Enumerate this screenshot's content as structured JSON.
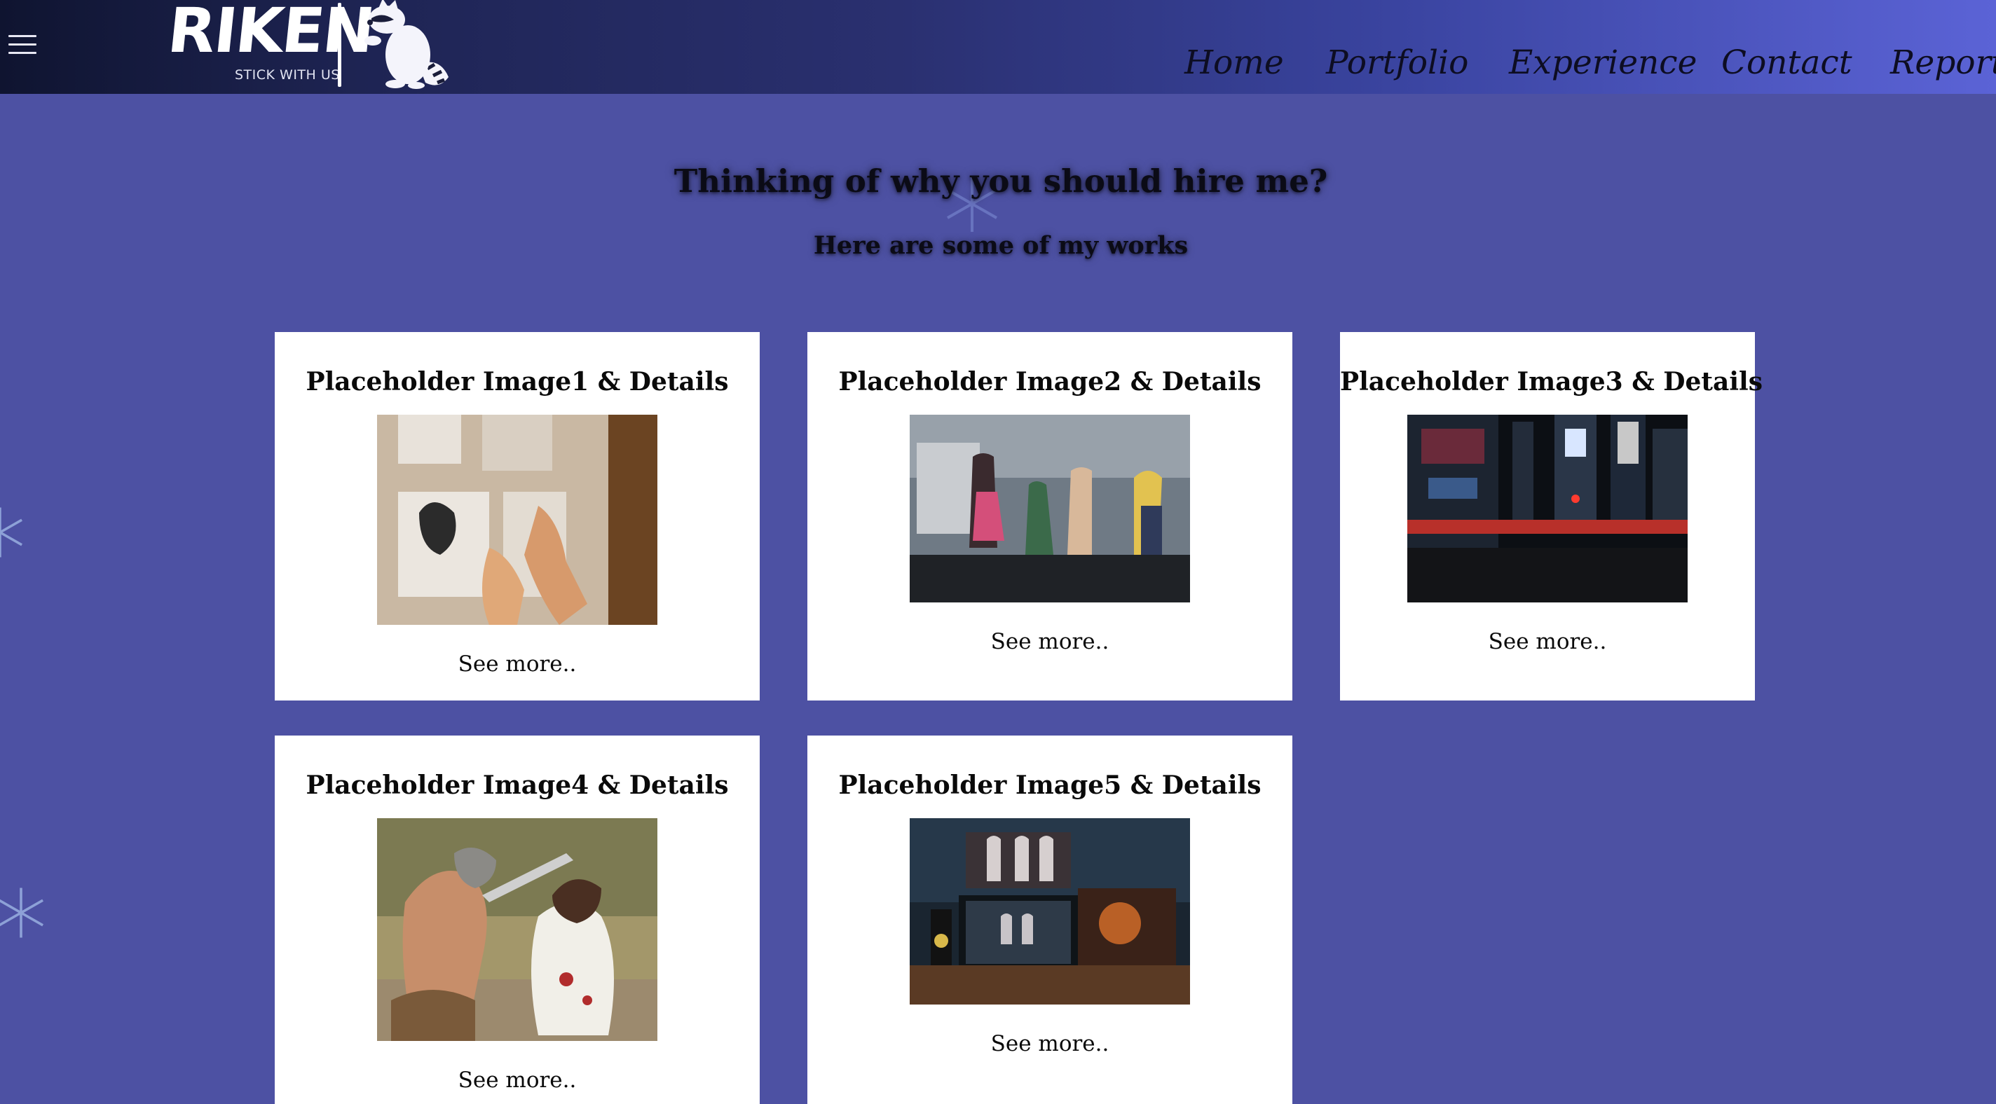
{
  "header": {
    "logo_text": "RIKEN",
    "logo_tagline": "STICK WITH US",
    "nav": [
      {
        "label": "Home"
      },
      {
        "label": "Portfolio"
      },
      {
        "label": "Experience"
      },
      {
        "label": "Contact"
      },
      {
        "label": "Report"
      }
    ]
  },
  "intro": {
    "title": "Thinking of why you should hire me?",
    "subtitle": "Here are some of my works"
  },
  "cards": [
    {
      "title": "Placeholder Image1 & Details",
      "link": "See more..",
      "image": "anime-sketch-photo"
    },
    {
      "title": "Placeholder Image2 & Details",
      "link": "See more..",
      "image": "anime-figurines-photo"
    },
    {
      "title": "Placeholder Image3 & Details",
      "link": "See more..",
      "image": "city-night-street-photo"
    },
    {
      "title": "Placeholder Image4 & Details",
      "link": "See more..",
      "image": "cosplay-fight-photo"
    },
    {
      "title": "Placeholder Image5 & Details",
      "link": "See more..",
      "image": "editing-desk-monitors-photo"
    }
  ],
  "icons": {
    "menu": "hamburger-icon",
    "mascot": "raccoon-icon",
    "decoration": "snowflake-icon"
  },
  "colors": {
    "background": "#4d51a3",
    "card": "#ffffff",
    "header_dark": "#0f1430",
    "header_light": "#5b63d6"
  }
}
